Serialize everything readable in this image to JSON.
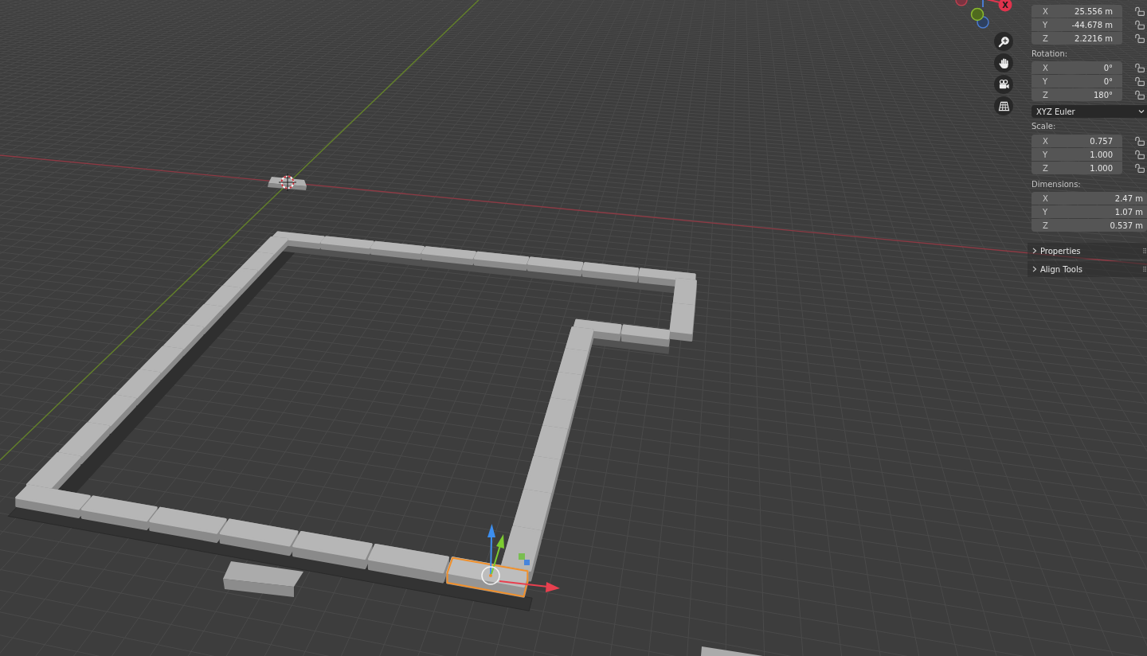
{
  "navigation_gizmo": {
    "x_axis_label": "X"
  },
  "sidebar": {
    "location": {
      "fields": [
        {
          "axis": "X",
          "value": "25.556 m",
          "locked": false
        },
        {
          "axis": "Y",
          "value": "-44.678 m",
          "locked": false
        },
        {
          "axis": "Z",
          "value": "2.2216 m",
          "locked": false
        }
      ]
    },
    "rotation": {
      "label": "Rotation:",
      "fields": [
        {
          "axis": "X",
          "value": "0°",
          "locked": false
        },
        {
          "axis": "Y",
          "value": "0°",
          "locked": false
        },
        {
          "axis": "Z",
          "value": "180°",
          "locked": false
        }
      ],
      "mode": "XYZ Euler"
    },
    "scale": {
      "label": "Scale:",
      "fields": [
        {
          "axis": "X",
          "value": "0.757",
          "locked": false
        },
        {
          "axis": "Y",
          "value": "1.000",
          "locked": false
        },
        {
          "axis": "Z",
          "value": "1.000",
          "locked": false
        }
      ]
    },
    "dimensions": {
      "label": "Dimensions:",
      "fields": [
        {
          "axis": "X",
          "value": "2.47 m"
        },
        {
          "axis": "Y",
          "value": "1.07 m"
        },
        {
          "axis": "Z",
          "value": "0.537 m"
        }
      ]
    },
    "panels": [
      {
        "label": "Properties",
        "expanded": false
      },
      {
        "label": "Align Tools",
        "expanded": false
      }
    ]
  }
}
